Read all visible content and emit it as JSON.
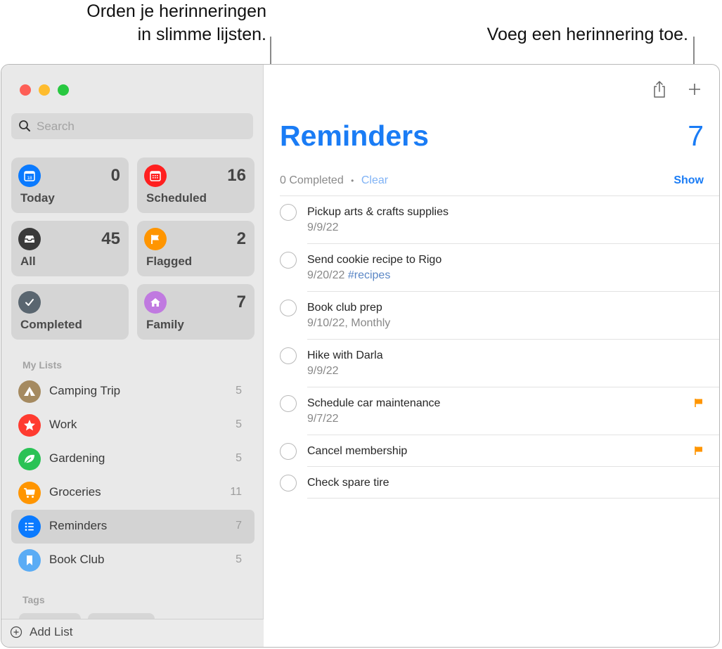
{
  "callouts": {
    "left_line1": "Orden je herinneringen",
    "left_line2": "in slimme lijsten.",
    "right": "Voeg een herinnering toe."
  },
  "window_controls": [
    {
      "name": "close",
      "color": "#fe5f57"
    },
    {
      "name": "minimize",
      "color": "#febc2e"
    },
    {
      "name": "zoom",
      "color": "#28c840"
    }
  ],
  "sidebar": {
    "search": {
      "placeholder": "Search",
      "value": ""
    },
    "smart_lists": [
      {
        "label": "Today",
        "count": "0",
        "icon": "calendar-today-icon",
        "color": "#0a7aff"
      },
      {
        "label": "Scheduled",
        "count": "16",
        "icon": "calendar-grid-icon",
        "color": "#ff1f1f"
      },
      {
        "label": "All",
        "count": "45",
        "icon": "tray-icon",
        "color": "#3a3a3a"
      },
      {
        "label": "Flagged",
        "count": "2",
        "icon": "flag-icon",
        "color": "#ff9500"
      },
      {
        "label": "Completed",
        "count": "",
        "icon": "checkmark-icon",
        "color": "#5a6670"
      },
      {
        "label": "Family",
        "count": "7",
        "icon": "house-icon",
        "color": "#c07ae0"
      }
    ],
    "my_lists_title": "My Lists",
    "my_lists": [
      {
        "label": "Camping Trip",
        "count": "5",
        "icon": "tent-icon",
        "color": "#a58a60",
        "selected": false
      },
      {
        "label": "Work",
        "count": "5",
        "icon": "star-icon",
        "color": "#ff3b30",
        "selected": false
      },
      {
        "label": "Gardening",
        "count": "5",
        "icon": "leaf-icon",
        "color": "#2ac255",
        "selected": false
      },
      {
        "label": "Groceries",
        "count": "11",
        "icon": "cart-icon",
        "color": "#ff9500",
        "selected": false
      },
      {
        "label": "Reminders",
        "count": "7",
        "icon": "list-bullet-icon",
        "color": "#0a7aff",
        "selected": true
      },
      {
        "label": "Book Club",
        "count": "5",
        "icon": "bookmark-icon",
        "color": "#5aacf5",
        "selected": false
      }
    ],
    "tags_title": "Tags",
    "add_list_label": "Add List"
  },
  "main": {
    "title": "Reminders",
    "count": "7",
    "completed_text": "0 Completed",
    "separator": "•",
    "clear_label": "Clear",
    "show_label": "Show",
    "accent_color": "#1a7cf5",
    "reminders": [
      {
        "title": "Pickup arts & crafts supplies",
        "subtitle": "9/9/22",
        "tag": "",
        "flagged": false
      },
      {
        "title": "Send cookie recipe to Rigo",
        "subtitle": "9/20/22",
        "tag": "#recipes",
        "flagged": false
      },
      {
        "title": "Book club prep",
        "subtitle": "9/10/22, Monthly",
        "tag": "",
        "flagged": false
      },
      {
        "title": "Hike with Darla",
        "subtitle": "9/9/22",
        "tag": "",
        "flagged": false
      },
      {
        "title": "Schedule car maintenance",
        "subtitle": "9/7/22",
        "tag": "",
        "flagged": true
      },
      {
        "title": "Cancel membership",
        "subtitle": "",
        "tag": "",
        "flagged": true
      },
      {
        "title": "Check spare tire",
        "subtitle": "",
        "tag": "",
        "flagged": false
      }
    ]
  }
}
